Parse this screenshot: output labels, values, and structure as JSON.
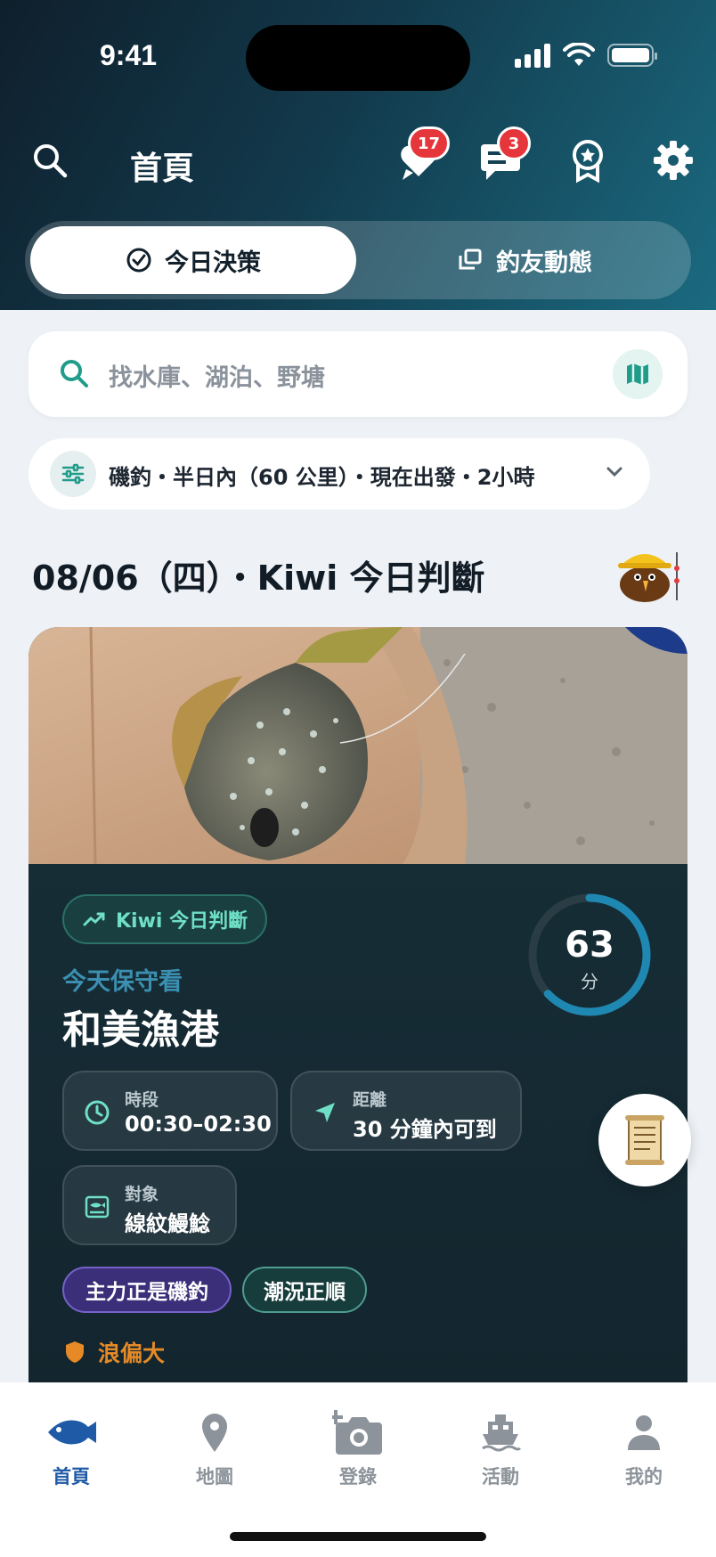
{
  "status_bar": {
    "time": "9:41"
  },
  "header": {
    "title": "首頁",
    "likes_badge": "17",
    "messages_badge": "3"
  },
  "tabs": [
    {
      "label": "今日決策",
      "active": true
    },
    {
      "label": "釣友動態",
      "active": false
    }
  ],
  "search": {
    "placeholder": "找水庫、湖泊、野塘"
  },
  "filter": {
    "summary": "磯釣・半日內（60 公里）・現在出發・2小時"
  },
  "section": {
    "title": "08/06（四）・Kiwi 今日判斷"
  },
  "card": {
    "chip_label": "Kiwi 今日判斷",
    "score": {
      "value": "63",
      "unit": "分",
      "fraction": 0.63
    },
    "subhead": "今天保守看",
    "place": "和美漁港",
    "info": [
      {
        "label": "時段",
        "value": "00:30–02:30",
        "icon": "clock-icon"
      },
      {
        "label": "距離",
        "value": "30 分鐘內可到",
        "icon": "navigation-arrow-icon"
      },
      {
        "label": "對象",
        "value": "線紋鰻鯰",
        "icon": "fish-card-icon"
      }
    ],
    "tags": [
      "主力正是磯釣",
      "潮況正順"
    ],
    "warning": "浪偏大"
  },
  "bottom_nav": [
    {
      "label": "首頁",
      "icon": "fish-icon",
      "active": true
    },
    {
      "label": "地圖",
      "icon": "map-pin-icon",
      "active": false
    },
    {
      "label": "登錄",
      "icon": "add-photo-icon",
      "active": false
    },
    {
      "label": "活動",
      "icon": "ship-icon",
      "active": false
    },
    {
      "label": "我的",
      "icon": "person-icon",
      "active": false
    }
  ],
  "colors": {
    "accent_teal": "#1f9c8a",
    "active_nav": "#1f5aa6",
    "badge_red": "#e5363b",
    "warning_orange": "#e58a26",
    "score_ring": "#1f88b2"
  }
}
